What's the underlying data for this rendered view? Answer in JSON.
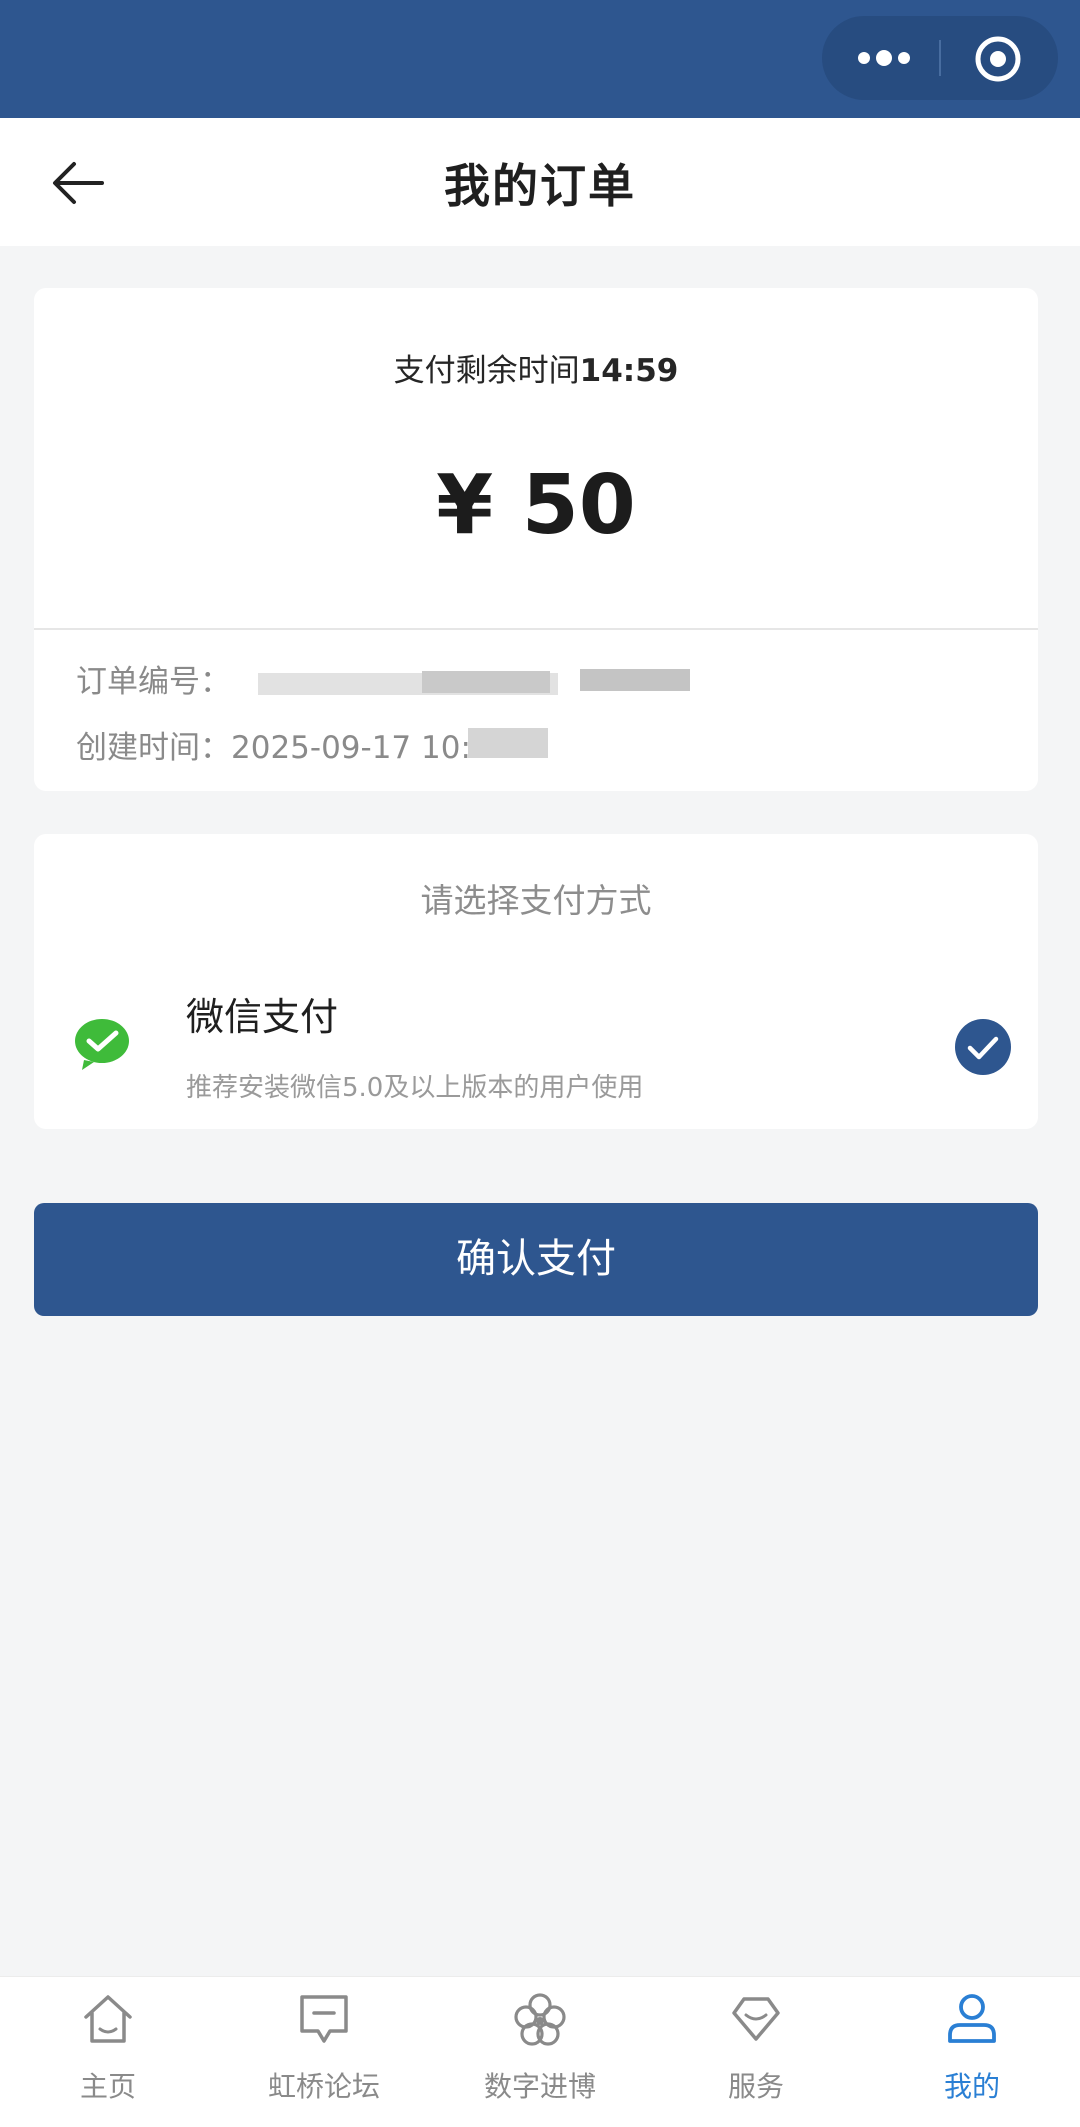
{
  "header": {
    "title": "我的订单"
  },
  "order": {
    "countdown_label": "支付剩余时间",
    "countdown_value": "14:59",
    "amount": "¥ 50",
    "order_no_label": "订单编号：",
    "created_label": "创建时间：",
    "created_value": "2025-09-17 10:"
  },
  "payment": {
    "hint": "请选择支付方式",
    "method_name": "微信支付",
    "method_desc": "推荐安装微信5.0及以上版本的用户使用",
    "selected": true
  },
  "actions": {
    "confirm_label": "确认支付"
  },
  "tabbar": {
    "items": [
      {
        "label": "主页",
        "icon": "home-icon"
      },
      {
        "label": "虹桥论坛",
        "icon": "forum-icon"
      },
      {
        "label": "数字进博",
        "icon": "flower-icon"
      },
      {
        "label": "服务",
        "icon": "diamond-icon"
      },
      {
        "label": "我的",
        "icon": "user-icon",
        "active": true
      }
    ]
  },
  "colors": {
    "brand": "#2e568f",
    "active_tab": "#2a7fd4",
    "wechat_green": "#3fbb3a"
  }
}
